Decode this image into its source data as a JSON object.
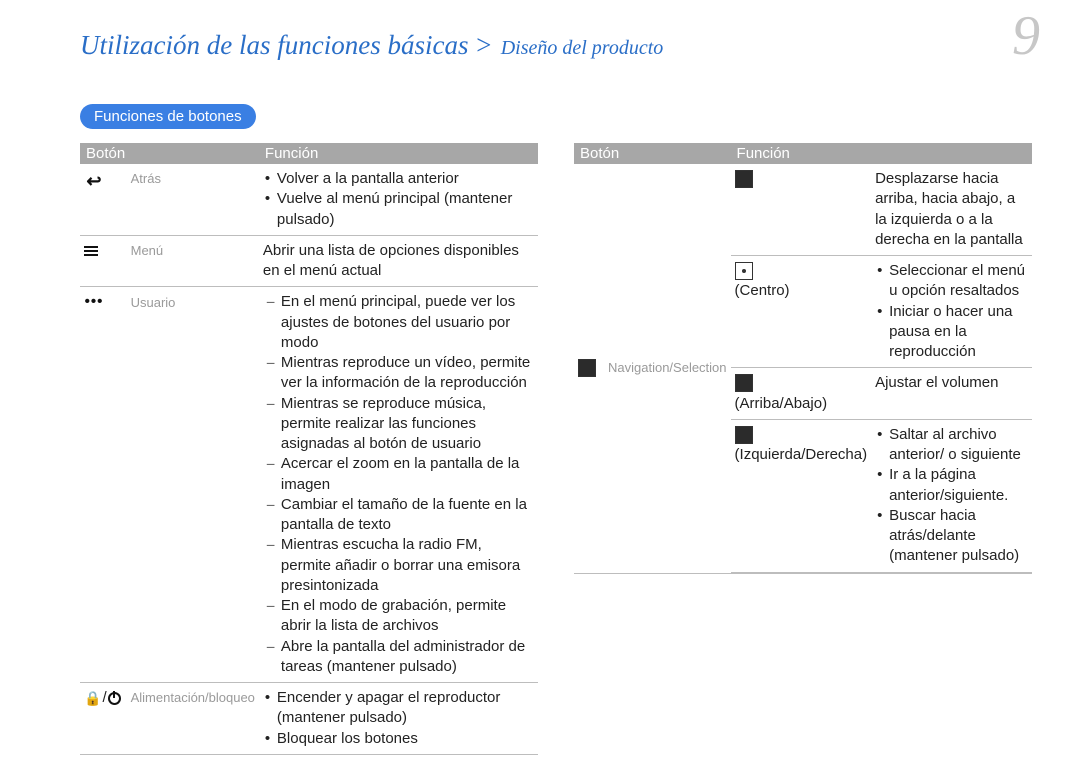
{
  "header": {
    "title": "Utilización de las funciones básicas",
    "separator": ">",
    "subtitle": "Diseño del producto",
    "page_number": "9"
  },
  "section": {
    "pill": "Funciones de botones"
  },
  "tableHeaders": {
    "button": "Botón",
    "function": "Función"
  },
  "left_table": {
    "rows": [
      {
        "icon_name": "back-icon",
        "label": "Atrás",
        "func_bullets": [
          "Volver a la pantalla anterior",
          "Vuelve al menú principal (mantener pulsado)"
        ]
      },
      {
        "icon_name": "menu-icon",
        "label": "Menú",
        "func_text": "Abrir una lista de opciones disponibles en el menú actual"
      },
      {
        "icon_name": "user-icon",
        "label": "Usuario",
        "func_dashes": [
          "En el menú principal, puede ver los ajustes de botones del usuario por modo",
          "Mientras reproduce un vídeo, permite ver la información de la reproducción",
          "Mientras se reproduce música, permite realizar las funciones asignadas al botón de usuario",
          "Acercar el zoom en la pantalla de la imagen",
          "Cambiar el tamaño de la fuente en la pantalla de texto",
          "Mientras escucha la radio FM, permite añadir o borrar una emisora presintonizada",
          "En el modo de grabación, permite abrir la lista de archivos",
          "Abre la pantalla del administrador de tareas (mantener pulsado)"
        ]
      },
      {
        "icon_name": "lock-power-icon",
        "label": "Alimentación/bloqueo",
        "func_bullets": [
          "Encender y apagar el reproductor (mantener pulsado)",
          "Bloquear los botones"
        ]
      }
    ]
  },
  "right_table": {
    "group_icon_name": "navigation-icon",
    "group_label": "Navigation/Selection",
    "subrows": [
      {
        "key_icon_name": "dpad-all-icon",
        "key_text": "",
        "func_text": "Desplazarse hacia arriba, hacia abajo, a la izquierda o a la derecha en la pantalla"
      },
      {
        "key_icon_name": "dpad-center-icon",
        "key_text": "(Centro)",
        "func_bullets": [
          "Seleccionar el menú u opción resaltados",
          "Iniciar o hacer una pausa en la reproducción"
        ]
      },
      {
        "key_icon_name": "dpad-updown-icon",
        "key_text": "(Arriba/Abajo)",
        "func_text": "Ajustar el volumen"
      },
      {
        "key_icon_name": "dpad-leftright-icon",
        "key_text": "(Izquierda/Derecha)",
        "func_bullets": [
          "Saltar al archivo anterior/ o siguiente",
          "Ir a la página anterior/siguiente.",
          "Buscar hacia atrás/delante (mantener pulsado)"
        ]
      }
    ]
  }
}
